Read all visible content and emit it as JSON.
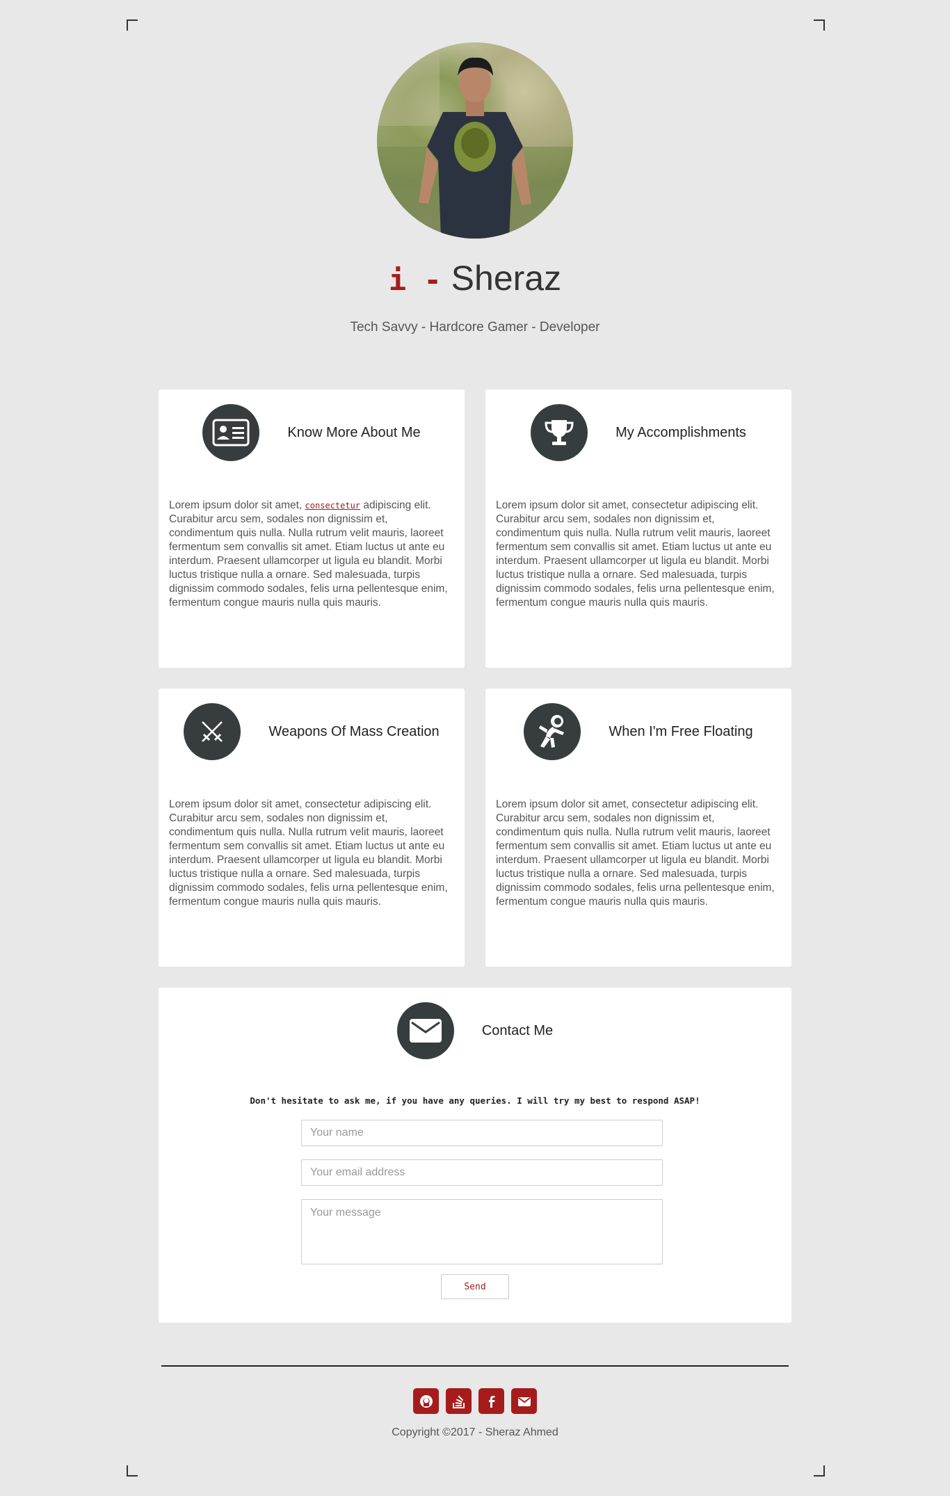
{
  "header": {
    "title_prefix": "i -",
    "title_name": "Sheraz",
    "subtitle": "Tech Savvy - Hardcore Gamer - Developer"
  },
  "cards": [
    {
      "icon": "id-card-icon",
      "title": "Know More About Me",
      "text_before": "Lorem ipsum dolor sit amet, ",
      "code": "consectetur",
      "text_after": " adipiscing elit. Curabitur arcu sem, sodales non dignissim et, condimentum quis nulla. Nulla rutrum velit mauris, laoreet fermentum sem convallis sit amet. Etiam luctus ut ante eu interdum. Praesent ullamcorper ut ligula eu blandit. Morbi luctus tristique nulla a ornare. Sed malesuada, turpis dignissim commodo sodales, felis urna pellentesque enim, fermentum congue mauris nulla quis mauris."
    },
    {
      "icon": "trophy-icon",
      "title": "My Accomplishments",
      "text": "Lorem ipsum dolor sit amet, consectetur adipiscing elit. Curabitur arcu sem, sodales non dignissim et, condimentum quis nulla. Nulla rutrum velit mauris, laoreet fermentum sem convallis sit amet. Etiam luctus ut ante eu interdum. Praesent ullamcorper ut ligula eu blandit. Morbi luctus tristique nulla a ornare. Sed malesuada, turpis dignissim commodo sodales, felis urna pellentesque enim, fermentum congue mauris nulla quis mauris."
    },
    {
      "icon": "crossed-swords-icon",
      "title": "Weapons Of Mass Creation",
      "text": "Lorem ipsum dolor sit amet, consectetur adipiscing elit. Curabitur arcu sem, sodales non dignissim et, condimentum quis nulla. Nulla rutrum velit mauris, laoreet fermentum sem convallis sit amet. Etiam luctus ut ante eu interdum. Praesent ullamcorper ut ligula eu blandit. Morbi luctus tristique nulla a ornare. Sed malesuada, turpis dignissim commodo sodales, felis urna pellentesque enim, fermentum congue mauris nulla quis mauris."
    },
    {
      "icon": "astronaut-icon",
      "title": "When I'm Free Floating",
      "text": "Lorem ipsum dolor sit amet, consectetur adipiscing elit. Curabitur arcu sem, sodales non dignissim et, condimentum quis nulla. Nulla rutrum velit mauris, laoreet fermentum sem convallis sit amet. Etiam luctus ut ante eu interdum. Praesent ullamcorper ut ligula eu blandit. Morbi luctus tristique nulla a ornare. Sed malesuada, turpis dignissim commodo sodales, felis urna pellentesque enim, fermentum congue mauris nulla quis mauris."
    }
  ],
  "contact": {
    "icon": "envelope-icon",
    "title": "Contact Me",
    "note": "Don't hesitate to ask me, if you have any queries. I will try my best to respond ASAP!",
    "name_placeholder": "Your name",
    "email_placeholder": "Your email address",
    "message_placeholder": "Your message",
    "send_label": "Send"
  },
  "footer": {
    "socials": [
      "github-icon",
      "stackoverflow-icon",
      "facebook-icon",
      "envelope-icon"
    ],
    "copyright": "Copyright ©2017 - Sheraz Ahmed"
  },
  "colors": {
    "accent": "#a61c1c",
    "background": "#e8e8e8",
    "icon_circle": "#373d3f"
  }
}
